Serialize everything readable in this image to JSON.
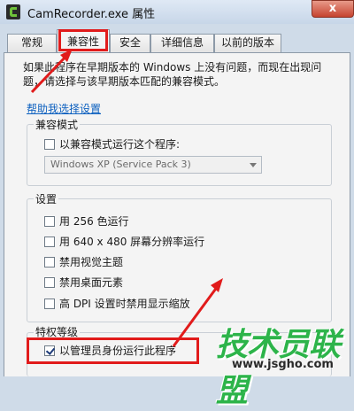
{
  "window": {
    "title": "CamRecorder.exe 属性",
    "close": "x"
  },
  "tabs": [
    {
      "label": "常规"
    },
    {
      "label": "兼容性",
      "active": true
    },
    {
      "label": "安全"
    },
    {
      "label": "详细信息"
    },
    {
      "label": "以前的版本"
    }
  ],
  "intro_text": "如果此程序在早期版本的 Windows 上没有问题，而现在出现问题，请选择与该早期版本匹配的兼容模式。",
  "help_link": "帮助我选择设置",
  "compat_mode": {
    "group_label": "兼容模式",
    "checkbox_label": "以兼容模式运行这个程序:",
    "checked": false,
    "select_value": "Windows XP (Service Pack 3)"
  },
  "settings": {
    "group_label": "设置",
    "items": [
      {
        "label": "用 256 色运行",
        "checked": false
      },
      {
        "label": "用 640 x 480 屏幕分辨率运行",
        "checked": false
      },
      {
        "label": "禁用视觉主题",
        "checked": false
      },
      {
        "label": "禁用桌面元素",
        "checked": false
      },
      {
        "label": "高 DPI 设置时禁用显示缩放",
        "checked": false
      }
    ]
  },
  "privilege": {
    "group_label": "特权等级",
    "checkbox_label": "以管理员身份运行此程序",
    "checked": true
  },
  "watermark": {
    "text": "技术员联盟",
    "url": "www.jsgho.com"
  },
  "colors": {
    "annotation_red": "#e11b1b",
    "watermark_green": "#2db44a",
    "link_blue": "#0b5fbf"
  }
}
